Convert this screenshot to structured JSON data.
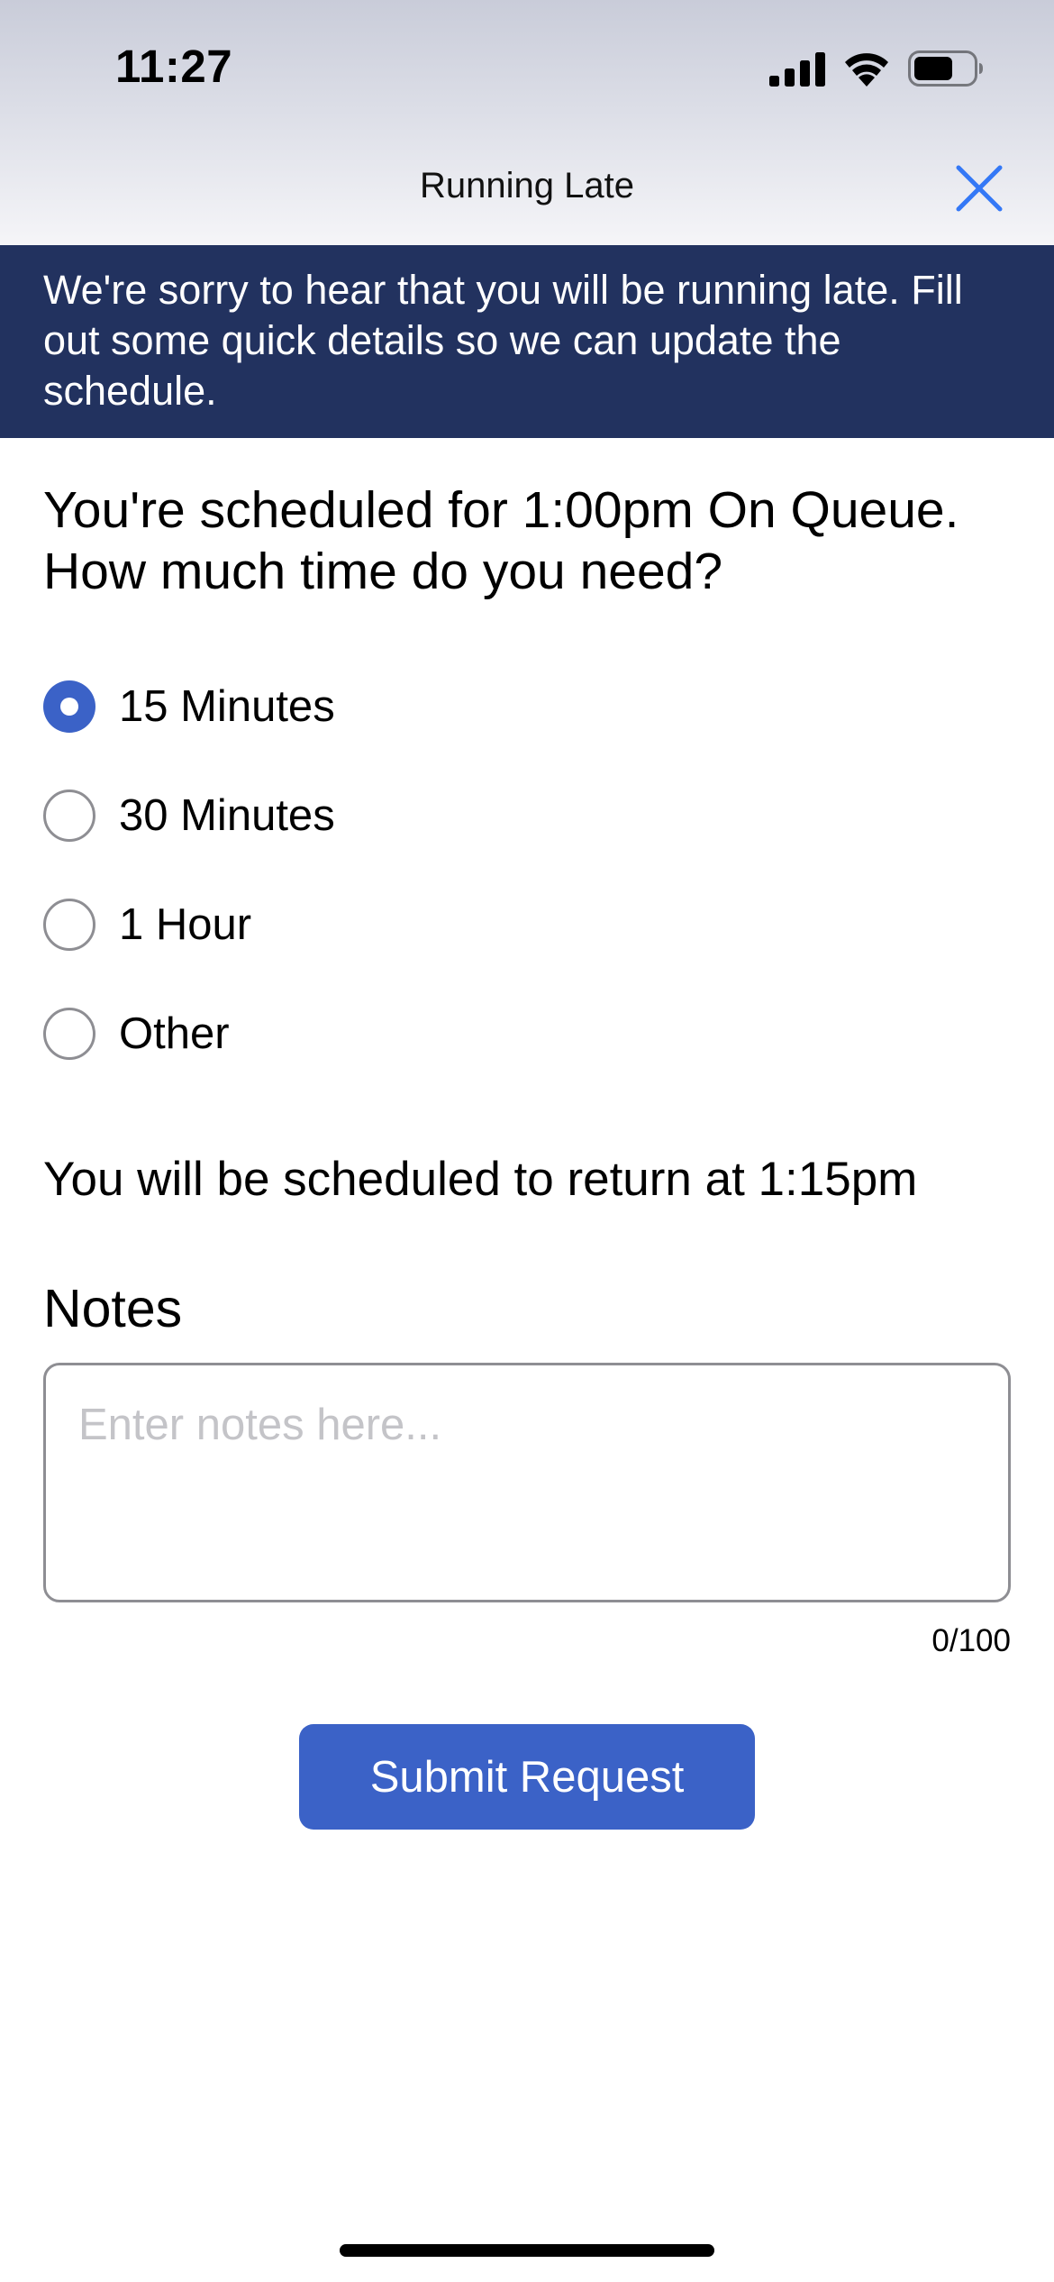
{
  "status_bar": {
    "time": "11:27",
    "icons": [
      "cellular-signal-icon",
      "wifi-icon",
      "battery-icon"
    ]
  },
  "nav": {
    "title": "Running Late",
    "close_icon": "close-icon"
  },
  "banner": {
    "message": "We're sorry to hear that you will be running late. Fill out some quick details so we can update the schedule."
  },
  "form": {
    "question": "You're scheduled for 1:00pm On Queue. How much time do you need?",
    "options": [
      {
        "label": "15 Minutes",
        "selected": true
      },
      {
        "label": "30 Minutes",
        "selected": false
      },
      {
        "label": "1 Hour",
        "selected": false
      },
      {
        "label": "Other",
        "selected": false
      }
    ],
    "return_text": "You will be scheduled to return at 1:15pm",
    "notes_label": "Notes",
    "notes_value": "",
    "notes_placeholder": "Enter notes here...",
    "char_count": "0/100",
    "submit_label": "Submit Request"
  },
  "colors": {
    "banner_bg": "#22325f",
    "accent": "#3b62c7",
    "close_icon": "#3478f6"
  }
}
